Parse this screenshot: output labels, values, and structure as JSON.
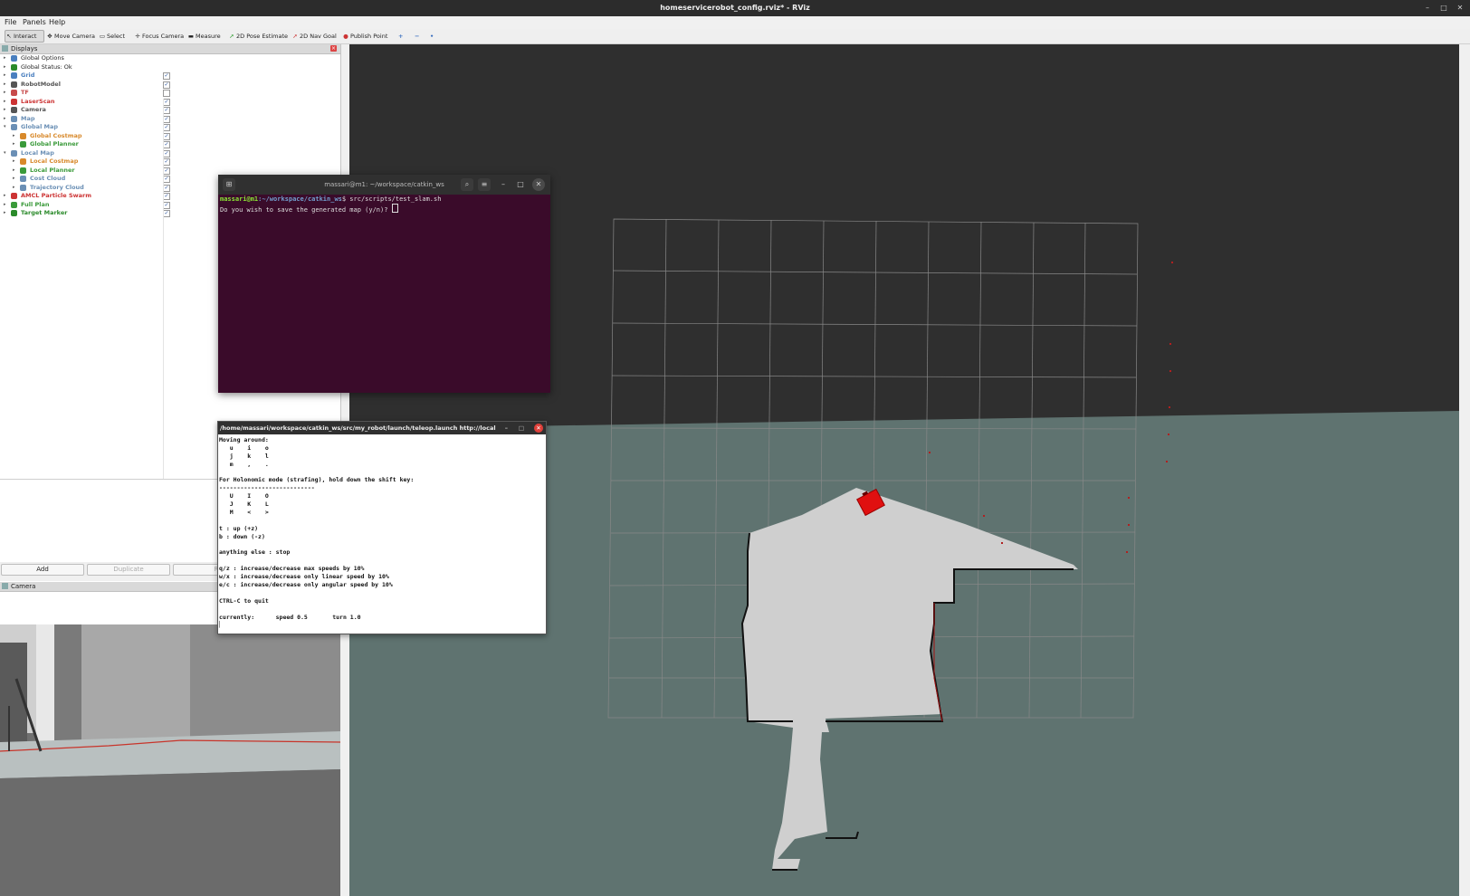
{
  "window": {
    "title": "homeservicerobot_config.rviz* - RViz"
  },
  "menu": [
    "File",
    "Panels",
    "Help"
  ],
  "toolbar": {
    "interact": "Interact",
    "move_camera": "Move Camera",
    "select": "Select",
    "focus_camera": "Focus Camera",
    "measure": "Measure",
    "pose_estimate": "2D Pose Estimate",
    "nav_goal": "2D Nav Goal",
    "publish_point": "Publish Point",
    "plus": "+",
    "minus": "−",
    "dot": "•"
  },
  "displays": {
    "title": "Displays",
    "items": [
      {
        "label": "Global Options",
        "level": 0,
        "checked": null,
        "color": "#4a7fbf",
        "icon": "globe-icon"
      },
      {
        "label": "Global Status: Ok",
        "level": 0,
        "checked": null,
        "color": "#2a8a2a",
        "icon": "check-icon"
      },
      {
        "label": "Grid",
        "level": 0,
        "checked": true,
        "color": "#4a7fbf",
        "icon": "grid-icon"
      },
      {
        "label": "RobotModel",
        "level": 0,
        "checked": true,
        "color": "#555555",
        "icon": "robot-icon"
      },
      {
        "label": "TF",
        "level": 0,
        "checked": false,
        "color": "#c74b4b",
        "icon": "tf-icon"
      },
      {
        "label": "LaserScan",
        "level": 0,
        "checked": true,
        "color": "#c33",
        "icon": "laser-icon"
      },
      {
        "label": "Camera",
        "level": 0,
        "checked": true,
        "color": "#555555",
        "icon": "camera-icon"
      },
      {
        "label": "Map",
        "level": 0,
        "checked": true,
        "color": "#6a8fb5",
        "icon": "map-icon"
      },
      {
        "label": "Global Map",
        "level": 0,
        "checked": true,
        "color": "#6a8fb5",
        "icon": "folder-icon"
      },
      {
        "label": "Global Costmap",
        "level": 1,
        "checked": true,
        "color": "#d8892b",
        "icon": "costmap-icon"
      },
      {
        "label": "Global Planner",
        "level": 1,
        "checked": true,
        "color": "#3a9a3a",
        "icon": "path-icon"
      },
      {
        "label": "Local Map",
        "level": 0,
        "checked": true,
        "color": "#6a8fb5",
        "icon": "folder-icon"
      },
      {
        "label": "Local Costmap",
        "level": 1,
        "checked": true,
        "color": "#d8892b",
        "icon": "costmap-icon"
      },
      {
        "label": "Local Planner",
        "level": 1,
        "checked": true,
        "color": "#3a9a3a",
        "icon": "path-icon"
      },
      {
        "label": "Cost Cloud",
        "level": 1,
        "checked": true,
        "color": "#6a8fb5",
        "icon": "cloud-icon"
      },
      {
        "label": "Trajectory Cloud",
        "level": 1,
        "checked": true,
        "color": "#6a8fb5",
        "icon": "cloud-icon"
      },
      {
        "label": "AMCL Particle Swarm",
        "level": 0,
        "checked": true,
        "color": "#c33",
        "icon": "pose-array-icon"
      },
      {
        "label": "Full Plan",
        "level": 0,
        "checked": true,
        "color": "#3a9a3a",
        "icon": "path-icon"
      },
      {
        "label": "Target Marker",
        "level": 0,
        "checked": true,
        "color": "#2a8a2a",
        "icon": "marker-icon"
      }
    ]
  },
  "panel_buttons": {
    "add": "Add",
    "duplicate": "Duplicate",
    "remove": "Rem"
  },
  "camera_panel": {
    "title": "Camera"
  },
  "terminal1": {
    "title": "massari@m1: ~/workspace/catkin_ws",
    "prompt_user": "massari@m1",
    "prompt_path": ":~/workspace/catkin_ws",
    "prompt_cmd": "$ src/scripts/test_slam.sh",
    "line2": "Do you wish to save the generated map (y/n)? ",
    "colors": {
      "bg": "#3a0b2a",
      "user": "#8ae234",
      "path": "#729fcf"
    }
  },
  "terminal2": {
    "title": "/home/massari/workspace/catkin_ws/src/my_robot/launch/teleop.launch http://local...",
    "lines": [
      "Moving around:",
      "   u    i    o",
      "   j    k    l",
      "   m    ,    .",
      "",
      "For Holonomic mode (strafing), hold down the shift key:",
      "---------------------------",
      "   U    I    O",
      "   J    K    L",
      "   M    <    >",
      "",
      "t : up (+z)",
      "b : down (-z)",
      "",
      "anything else : stop",
      "",
      "q/z : increase/decrease max speeds by 10%",
      "w/x : increase/decrease only linear speed by 10%",
      "e/c : increase/decrease only angular speed by 10%",
      "",
      "CTRL-C to quit",
      "",
      "currently:      speed 0.5       turn 1.0",
      "▏"
    ]
  },
  "scene": {
    "map_unknown_color": "#5f7370",
    "free_color": "#cfcfcf",
    "robot_color": "#e01010"
  }
}
